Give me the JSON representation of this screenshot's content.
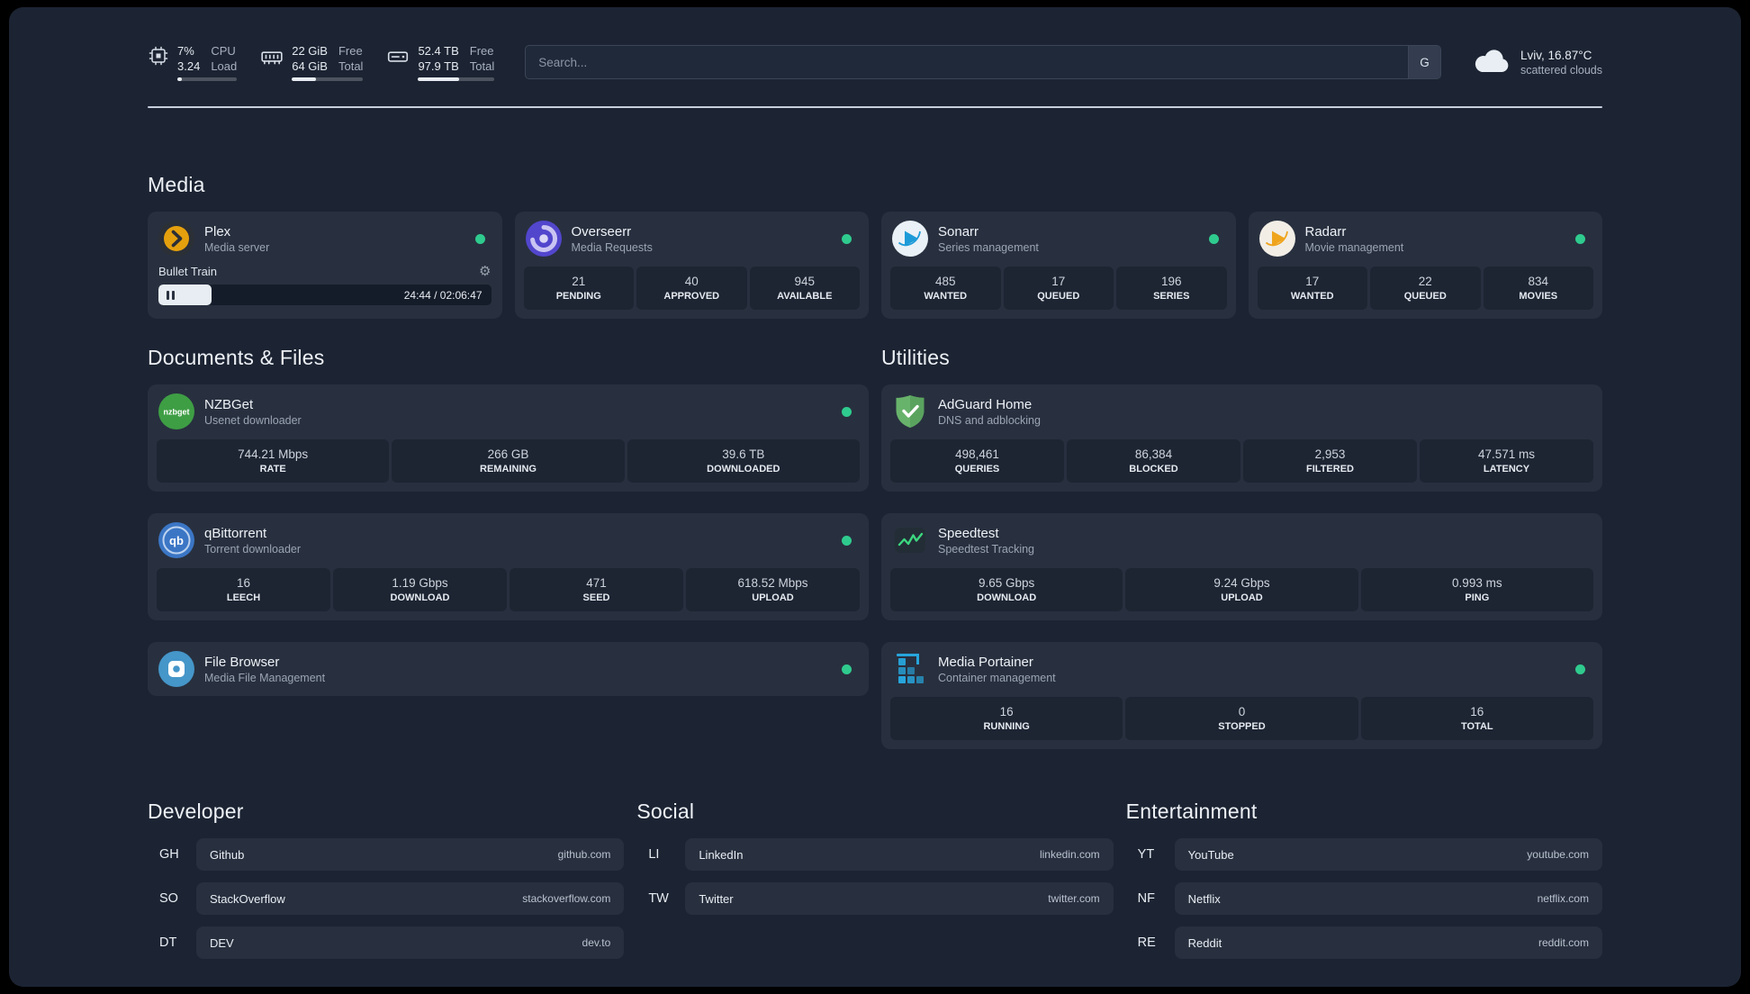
{
  "theme": {
    "page_background": "#1c2433",
    "card_background": "#28303f",
    "tile_background": "#1d2533",
    "status_online_color": "#2fcb8e"
  },
  "topbar": {
    "resources": [
      {
        "icon": "cpu-icon",
        "value1": "7%",
        "value2": "3.24",
        "label1": "CPU",
        "label2": "Load",
        "bar_percent": 7
      },
      {
        "icon": "memory-icon",
        "value1": "22 GiB",
        "value2": "64 GiB",
        "label1": "Free",
        "label2": "Total",
        "bar_percent": 34
      },
      {
        "icon": "disk-icon",
        "value1": "52.4 TB",
        "value2": "97.9 TB",
        "label1": "Free",
        "label2": "Total",
        "bar_percent": 54
      }
    ],
    "search": {
      "placeholder": "Search...",
      "provider_button": "G"
    },
    "weather": {
      "icon": "cloud-icon",
      "location": "Lviv, 16.87°C",
      "condition": "scattered clouds"
    }
  },
  "media": {
    "title": "Media",
    "cards": [
      {
        "icon": "plex-icon",
        "name": "Plex",
        "desc": "Media server",
        "status": "online",
        "player": {
          "track": "Bullet Train",
          "time": "24:44 / 02:06:47",
          "progress_percent": 16
        }
      },
      {
        "icon": "overseerr-icon",
        "name": "Overseerr",
        "desc": "Media Requests",
        "status": "online",
        "stats": [
          {
            "value": "21",
            "label": "PENDING"
          },
          {
            "value": "40",
            "label": "APPROVED"
          },
          {
            "value": "945",
            "label": "AVAILABLE"
          }
        ]
      },
      {
        "icon": "sonarr-icon",
        "name": "Sonarr",
        "desc": "Series management",
        "status": "online",
        "stats": [
          {
            "value": "485",
            "label": "WANTED"
          },
          {
            "value": "17",
            "label": "QUEUED"
          },
          {
            "value": "196",
            "label": "SERIES"
          }
        ]
      },
      {
        "icon": "radarr-icon",
        "name": "Radarr",
        "desc": "Movie management",
        "status": "online",
        "stats": [
          {
            "value": "17",
            "label": "WANTED"
          },
          {
            "value": "22",
            "label": "QUEUED"
          },
          {
            "value": "834",
            "label": "MOVIES"
          }
        ]
      }
    ]
  },
  "documents": {
    "title": "Documents & Files",
    "cards": [
      {
        "icon": "nzbget-icon",
        "name": "NZBGet",
        "desc": "Usenet downloader",
        "status": "online",
        "stats": [
          {
            "value": "744.21 Mbps",
            "label": "RATE"
          },
          {
            "value": "266 GB",
            "label": "REMAINING"
          },
          {
            "value": "39.6 TB",
            "label": "DOWNLOADED"
          }
        ]
      },
      {
        "icon": "qbittorrent-icon",
        "name": "qBittorrent",
        "desc": "Torrent downloader",
        "status": "online",
        "stats": [
          {
            "value": "16",
            "label": "LEECH"
          },
          {
            "value": "1.19 Gbps",
            "label": "DOWNLOAD"
          },
          {
            "value": "471",
            "label": "SEED"
          },
          {
            "value": "618.52 Mbps",
            "label": "UPLOAD"
          }
        ]
      },
      {
        "icon": "filebrowser-icon",
        "name": "File Browser",
        "desc": "Media File Management",
        "status": "online"
      }
    ]
  },
  "utilities": {
    "title": "Utilities",
    "cards": [
      {
        "icon": "adguard-icon",
        "name": "AdGuard Home",
        "desc": "DNS and adblocking",
        "stats": [
          {
            "value": "498,461",
            "label": "QUERIES"
          },
          {
            "value": "86,384",
            "label": "BLOCKED"
          },
          {
            "value": "2,953",
            "label": "FILTERED"
          },
          {
            "value": "47.571 ms",
            "label": "LATENCY"
          }
        ]
      },
      {
        "icon": "speedtest-icon",
        "name": "Speedtest",
        "desc": "Speedtest Tracking",
        "stats": [
          {
            "value": "9.65 Gbps",
            "label": "DOWNLOAD"
          },
          {
            "value": "9.24 Gbps",
            "label": "UPLOAD"
          },
          {
            "value": "0.993 ms",
            "label": "PING"
          }
        ]
      },
      {
        "icon": "portainer-icon",
        "name": "Media Portainer",
        "desc": "Container management",
        "status": "online",
        "stats": [
          {
            "value": "16",
            "label": "RUNNING"
          },
          {
            "value": "0",
            "label": "STOPPED"
          },
          {
            "value": "16",
            "label": "TOTAL"
          }
        ]
      }
    ]
  },
  "bookmarks": {
    "groups": [
      {
        "title": "Developer",
        "items": [
          {
            "abbr": "GH",
            "name": "Github",
            "url": "github.com"
          },
          {
            "abbr": "SO",
            "name": "StackOverflow",
            "url": "stackoverflow.com"
          },
          {
            "abbr": "DT",
            "name": "DEV",
            "url": "dev.to"
          }
        ]
      },
      {
        "title": "Social",
        "items": [
          {
            "abbr": "LI",
            "name": "LinkedIn",
            "url": "linkedin.com"
          },
          {
            "abbr": "TW",
            "name": "Twitter",
            "url": "twitter.com"
          }
        ]
      },
      {
        "title": "Entertainment",
        "items": [
          {
            "abbr": "YT",
            "name": "YouTube",
            "url": "youtube.com"
          },
          {
            "abbr": "NF",
            "name": "Netflix",
            "url": "netflix.com"
          },
          {
            "abbr": "RE",
            "name": "Reddit",
            "url": "reddit.com"
          }
        ]
      }
    ]
  }
}
